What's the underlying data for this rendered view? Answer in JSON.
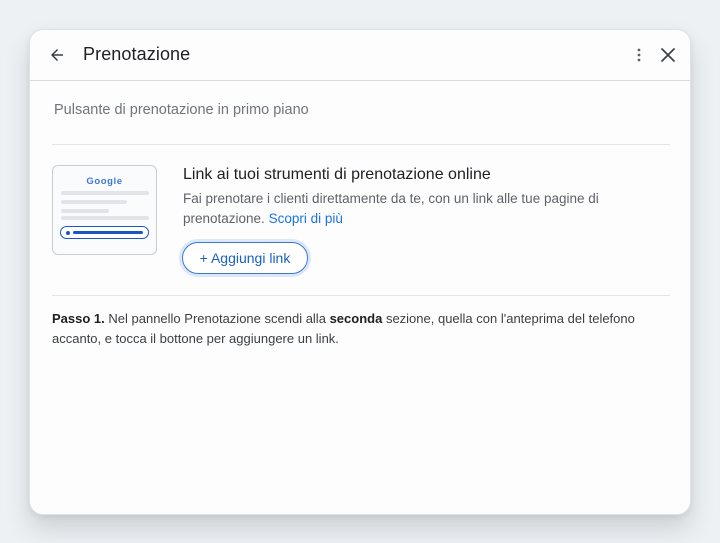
{
  "header": {
    "title": "Prenotazione",
    "back_icon": "arrow-back-icon",
    "more_icon": "more-vert-icon",
    "close_icon": "close-icon"
  },
  "section": {
    "label": "Pulsante di prenotazione in primo piano"
  },
  "thumbnail": {
    "brand": "Google"
  },
  "card": {
    "title": "Link ai tuoi strumenti di prenotazione online",
    "description": "Fai prenotare i clienti direttamente da te, con un link alle tue pagine di prenotazione.",
    "learn_more": "Scopri di più",
    "add_link_label": "+ Aggiungi link"
  },
  "instructions": {
    "step_label": "Passo 1.",
    "text_before": "Nel pannello Prenotazione scendi alla",
    "emphasis": "seconda",
    "text_after": "sezione, quella con l'anteprima del telefono accanto, e tocca il bottone per aggiungere un link."
  },
  "colors": {
    "accent": "#1a73e8",
    "button_border": "#3c78d8",
    "page_background": "#edf1f4"
  }
}
